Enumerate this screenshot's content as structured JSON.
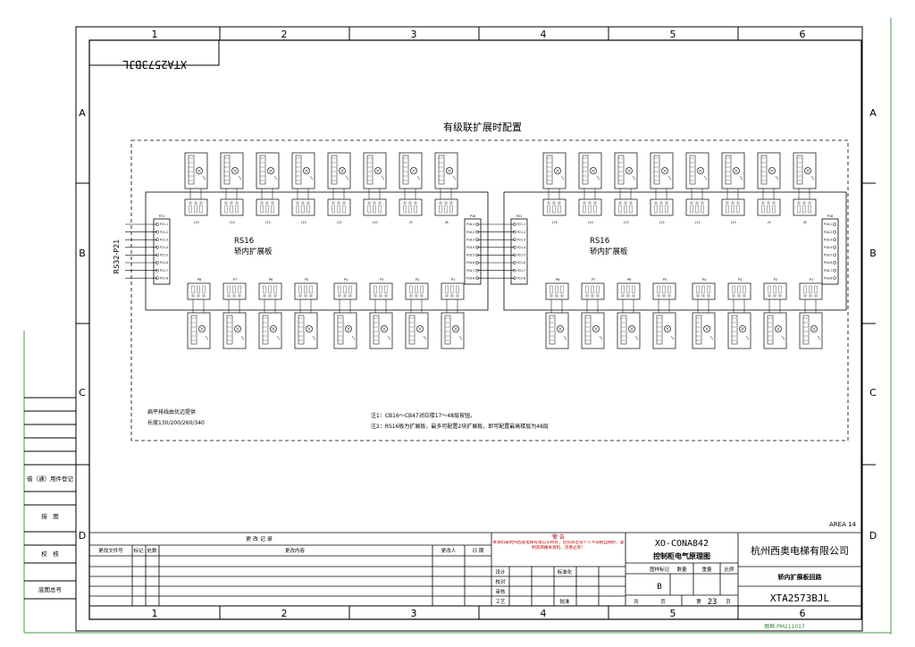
{
  "sheet": {
    "col_numbers": [
      "1",
      "2",
      "3",
      "4",
      "5",
      "6"
    ],
    "row_letters": [
      "A",
      "B",
      "C",
      "D"
    ],
    "mirrored_code": "XTA2573BJL",
    "area_label": "AREA 14",
    "footer_code": "图框.PM211017"
  },
  "left_strip": [
    "借（通）用件登记",
    "描　图",
    "校　核",
    "底图总号"
  ],
  "diagram": {
    "title": "有级联扩展时配置",
    "left_board": {
      "line1": "RS16",
      "line2": "轿内扩展板"
    },
    "right_board": {
      "line1": "RS16",
      "line2": "轿内扩展板"
    },
    "bus_label": "RS32-P21",
    "left_conn": "P21",
    "mid_conn": "P18",
    "right_conn_in": "P21",
    "right_conn_out": "P18",
    "left_pins": [
      "P21-1",
      "P21-2",
      "P21-3",
      "P21-4",
      "P21-5",
      "P21-6",
      "P21-7",
      "P21-8"
    ],
    "mid_pins": [
      "P18-1",
      "P18-2",
      "P18-3",
      "P18-4",
      "P18-5",
      "P18-6",
      "P18-7",
      "P18-8"
    ],
    "top_left_labels": [
      "J15",
      "J14",
      "J13",
      "J12",
      "J11",
      "J10",
      "J9",
      "J8"
    ],
    "top_right_labels": [
      "J15",
      "J14",
      "J13",
      "J12",
      "J11",
      "J10",
      "J9",
      "J8"
    ],
    "bottom_left_labels": [
      "P8",
      "P7",
      "P6",
      "P5",
      "P4",
      "P3",
      "P2",
      "P1"
    ],
    "bottom_right_labels": [
      "P8",
      "P7",
      "P6",
      "P5",
      "P4",
      "P3",
      "P2",
      "P1"
    ],
    "note_cable_1": "扁平排线由优迈提供",
    "note_cable_2": "长度130/200/260/340",
    "note_1": "注1：CB16～CB47对应楼17～48层按钮。",
    "note_2": "注2：RS16板为扩展板，最多可配置2块扩展板，即可配置最高楼层为48层"
  },
  "title_block": {
    "rev_title": "更 改 记 录",
    "rev_headers": [
      "更改文件号",
      "标记",
      "处数",
      "更改内容",
      "更改人",
      "日 期"
    ],
    "warning_title": "警 告",
    "warning_text": "本资料属杭州西奥电梯有限公司所有，任何单位或个人不得擅自摘抄、复制及转播本资料，违者必究！",
    "sign_labels": [
      "设计",
      "校对",
      "审核",
      "工艺"
    ],
    "std_label": "标准化",
    "approve_label": "批准",
    "drawing_no": "XO-CONA842",
    "drawing_title": "控制柜电气原理图",
    "stage_label": "图样标记",
    "qty_label": "数量",
    "weight_label": "重量",
    "scale_label": "比例",
    "stage_value": "B",
    "total_label": "共",
    "sheet_word": "页",
    "page_prefix": "第",
    "page_number": "23",
    "page_suffix": "页",
    "company": "杭州西奥电梯有限公司",
    "sheet_name": "轿内扩展板回路",
    "code": "XTA2573BJL"
  }
}
